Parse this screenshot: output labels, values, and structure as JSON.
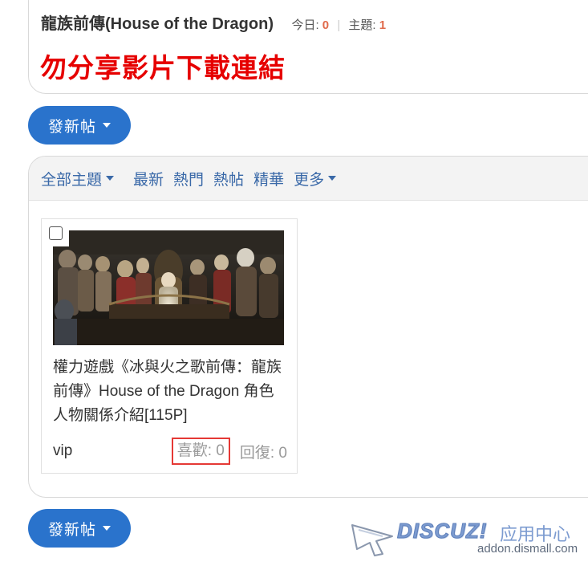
{
  "forum": {
    "name": "龍族前傳(House of the Dragon)",
    "today_label": "今日: ",
    "today_count": "0",
    "threads_label": "主題: ",
    "threads_count": "1",
    "notice": "勿分享影片下載連結"
  },
  "new_post_button": {
    "label": "發新帖"
  },
  "tabs": {
    "all": "全部主題",
    "latest": "最新",
    "hot": "熱門",
    "hot_posts": "熱帖",
    "digest": "精華",
    "more": "更多"
  },
  "thread": {
    "title": "權力遊戲《冰與火之歌前傳：龍族前傳》House of the Dragon 角色人物關係介紹[115P]",
    "author": "vip",
    "likes_label": "喜歡: 0",
    "replies_label": "回復: 0"
  },
  "watermark": {
    "brand": "DISCUZ!",
    "brand_cn": "应用中心",
    "url": "addon.dismall.com"
  },
  "colors": {
    "accent_blue": "#2a73cc",
    "link_blue": "#3a69a8",
    "warning_red": "#e60000",
    "count_orange": "#e06a4b",
    "highlight_red": "#e53935"
  }
}
